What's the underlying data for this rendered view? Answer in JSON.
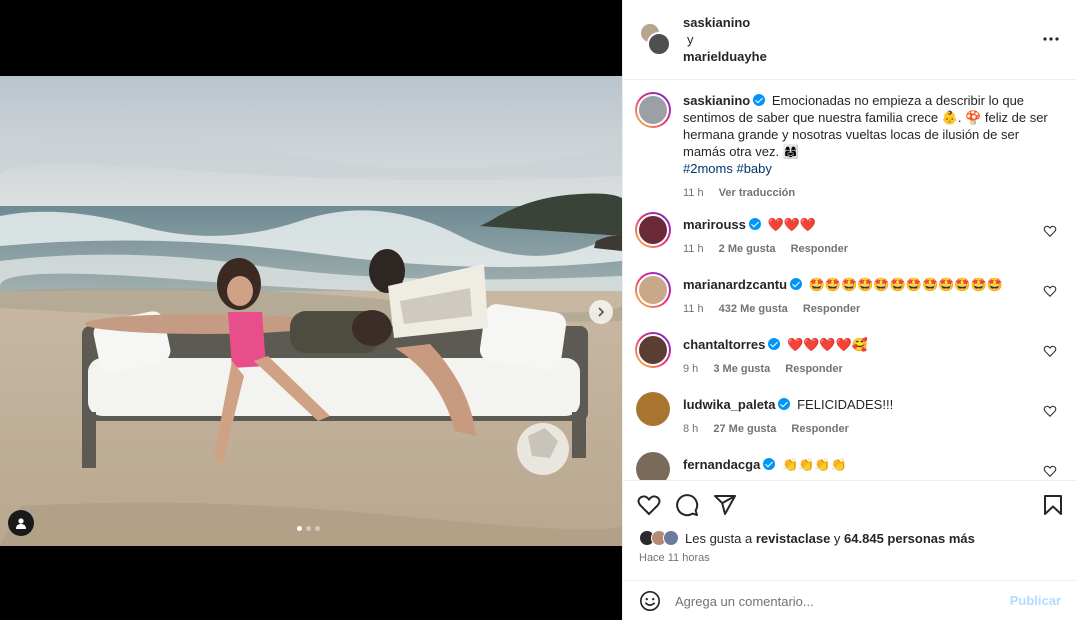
{
  "header": {
    "user1": "saskianino",
    "joiner": "y",
    "user2": "marielduayhe"
  },
  "caption": {
    "username": "saskianino",
    "text": "Emocionadas no empieza a describir lo que sentimos de saber que nuestra familia crece 👶. 🍄 feliz de ser hermana grande y nosotras vueltas locas de ilusión de ser mamás otra vez. 👩‍👩‍👧",
    "hashtags": "#2moms #baby",
    "time": "11 h",
    "translate": "Ver traducción"
  },
  "comments": [
    {
      "username": "marirouss",
      "text": "❤️❤️❤️",
      "time": "11 h",
      "likes": "2 Me gusta",
      "reply": "Responder",
      "avatar_color": "#6b2a3a"
    },
    {
      "username": "marianardzcantu",
      "text": "🤩🤩🤩🤩🤩🤩🤩🤩🤩🤩🤩🤩",
      "time": "11 h",
      "likes": "432 Me gusta",
      "reply": "Responder",
      "avatar_color": "#c9a88a"
    },
    {
      "username": "chantaltorres",
      "text": "❤️❤️❤️❤️🥰",
      "time": "9 h",
      "likes": "3 Me gusta",
      "reply": "Responder",
      "avatar_color": "#5a3d33"
    },
    {
      "username": "ludwika_paleta",
      "text": "FELICIDADES!!!",
      "time": "8 h",
      "likes": "27 Me gusta",
      "reply": "Responder",
      "avatar_color": "#a8752e"
    },
    {
      "username": "fernandacga",
      "text": "👏👏👏👏",
      "time": "",
      "likes": "",
      "reply": "",
      "avatar_color": "#7a6a5a"
    }
  ],
  "likes": {
    "prefix": "Les gusta a",
    "user": "revistaclase",
    "suffix": "y",
    "count": "64.845 personas más"
  },
  "time_ago": "Hace 11 horas",
  "add_comment": {
    "placeholder": "Agrega un comentario...",
    "publish": "Publicar"
  },
  "colors": {
    "accent": "#0095f6",
    "publish_disabled": "#b3dbff",
    "link": "#00376b"
  },
  "icons": [
    "heart-icon",
    "comment-icon",
    "share-icon",
    "bookmark-icon",
    "emoji-icon",
    "more-icon",
    "chevron-right-icon",
    "user-tag-icon"
  ]
}
